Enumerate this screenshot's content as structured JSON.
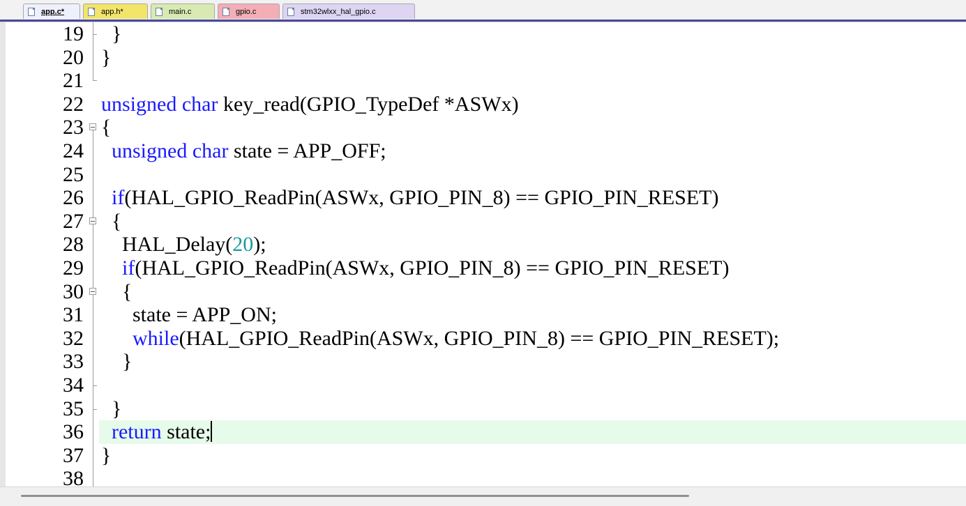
{
  "tabs": [
    {
      "label": "app.c*",
      "color": "#eef1fb",
      "active": true
    },
    {
      "label": "app.h*",
      "color": "#f2e56a",
      "active": false
    },
    {
      "label": "main.c",
      "color": "#d8eab2",
      "active": false
    },
    {
      "label": "gpio.c",
      "color": "#f3aeb6",
      "active": false
    },
    {
      "label": "stm32wlxx_hal_gpio.c",
      "color": "#ddd5f2",
      "active": false
    }
  ],
  "colors": {
    "keyword": "#1a1aff",
    "number": "#1a9a9a",
    "current_line": "#e6fbe9",
    "tab_underline": "#4a4a9a"
  },
  "editor": {
    "current_line_number": "36",
    "lines": [
      {
        "num": "19",
        "text": "  }"
      },
      {
        "num": "20",
        "text": "}"
      },
      {
        "num": "21",
        "text": ""
      },
      {
        "num": "22",
        "text": "unsigned char key_read(GPIO_TypeDef *ASWx)"
      },
      {
        "num": "23",
        "text": "{"
      },
      {
        "num": "24",
        "text": "  unsigned char state = APP_OFF;"
      },
      {
        "num": "25",
        "text": ""
      },
      {
        "num": "26",
        "text": "  if(HAL_GPIO_ReadPin(ASWx, GPIO_PIN_8) == GPIO_PIN_RESET)"
      },
      {
        "num": "27",
        "text": "  {"
      },
      {
        "num": "28",
        "text": "    HAL_Delay(20);"
      },
      {
        "num": "29",
        "text": "    if(HAL_GPIO_ReadPin(ASWx, GPIO_PIN_8) == GPIO_PIN_RESET)"
      },
      {
        "num": "30",
        "text": "    {"
      },
      {
        "num": "31",
        "text": "      state = APP_ON;"
      },
      {
        "num": "32",
        "text": "      while(HAL_GPIO_ReadPin(ASWx, GPIO_PIN_8) == GPIO_PIN_RESET);"
      },
      {
        "num": "33",
        "text": "    }"
      },
      {
        "num": "34",
        "text": ""
      },
      {
        "num": "35",
        "text": "  }"
      },
      {
        "num": "36",
        "text": "  return state;"
      },
      {
        "num": "37",
        "text": "}"
      },
      {
        "num": "38",
        "text": ""
      }
    ]
  }
}
